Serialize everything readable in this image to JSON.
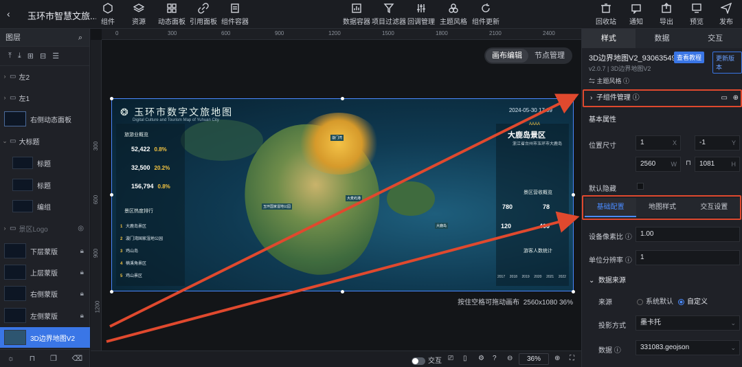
{
  "topbar": {
    "title": "玉环市智慧文旅...",
    "left_tools": [
      "组件",
      "资源",
      "动态面板",
      "引用面板",
      "组件容器"
    ],
    "center_tools": [
      "数据容器",
      "项目过滤器",
      "回调管理",
      "主题风格",
      "组件更新"
    ],
    "right_tools": [
      "回收站",
      "通知",
      "导出",
      "预览",
      "发布"
    ]
  },
  "layers": {
    "header": "图层",
    "items": [
      {
        "label": "左2",
        "type": "folder"
      },
      {
        "label": "左1",
        "type": "folder"
      },
      {
        "label": "右侧动态面板",
        "type": "panel"
      },
      {
        "label": "大标题",
        "type": "folder-open"
      },
      {
        "label": "标题",
        "type": "child"
      },
      {
        "label": "标题",
        "type": "child"
      },
      {
        "label": "编组",
        "type": "child"
      },
      {
        "label": "景区Logo",
        "type": "folder-dim"
      },
      {
        "label": "下层蒙版",
        "type": "locked"
      },
      {
        "label": "上层蒙版",
        "type": "locked"
      },
      {
        "label": "右侧蒙版",
        "type": "locked"
      },
      {
        "label": "左侧蒙版",
        "type": "locked"
      },
      {
        "label": "3D边界地图V2",
        "type": "selected"
      }
    ]
  },
  "canvas": {
    "ruler_h": [
      "0",
      "300",
      "600",
      "900",
      "1200",
      "1500",
      "1800",
      "2100",
      "2400"
    ],
    "ruler_v": [
      "300",
      "600",
      "900",
      "1200"
    ],
    "mode_tabs": [
      "画布编辑",
      "节点管理"
    ],
    "hint": "按住空格可拖动画布",
    "size_info": "2560x1080 36%",
    "interact_label": "交互",
    "zoom": "36%"
  },
  "artboard": {
    "title": "玉环市数字文旅地图",
    "subtitle": "Digital Culture and Tourism Map of Yuhuan City",
    "date": "2024-05-30 17:09",
    "scene_name": "大鹿岛景区",
    "scene_rating": "AAAA",
    "scene_sub": "浙江省台州市玉环市大鹿岛",
    "left_section1": "旅游业概览",
    "stats": [
      {
        "value": "52,422",
        "pct": "0.8%"
      },
      {
        "value": "32,500",
        "pct": "20.2%"
      },
      {
        "value": "156,794",
        "pct": "0.8%"
      }
    ],
    "left_section2": "景区热度排行",
    "ranking": [
      "大鹿岛景区",
      "漩门湾国家湿地公园",
      "鸡山岛",
      "楠溪角景区",
      "鸡山景区"
    ],
    "right_section1": "景区营收概览",
    "right_values": [
      "780",
      "78",
      "120",
      "400"
    ],
    "right_section2": "游客人数统计",
    "years": [
      "2017",
      "2018",
      "2019",
      "2020",
      "2021",
      "2022"
    ],
    "map_labels": [
      "漩门湾",
      "大麦屿港",
      "大鹿岛",
      "玉环国家湿地公园"
    ]
  },
  "props": {
    "tabs": [
      "样式",
      "数据",
      "交互"
    ],
    "component_name": "3D边界地图V2_93063549",
    "doc_btn": "查看教程",
    "update_btn": "更新版本",
    "version": "v2.0.7 | 3D边界地图V2",
    "theme": "主题风格",
    "sub_manage": "子组件管理",
    "basic": "基本属性",
    "pos_label": "位置尺寸",
    "x": "1",
    "y": "-1",
    "w": "2560",
    "h": "1081",
    "hidden_label": "默认隐藏",
    "sub_tabs": [
      "基础配置",
      "地图样式",
      "交互设置"
    ],
    "dpr_label": "设备像素比",
    "dpr": "1.00",
    "res_label": "单位分辨率",
    "res": "1",
    "datasource": "数据来源",
    "source_label": "来源",
    "source_opts": [
      "系统默认",
      "自定义"
    ],
    "proj_label": "投影方式",
    "proj": "墨卡托",
    "data_label": "数据",
    "data_val": "331083.geojson"
  },
  "colors": {
    "accent": "#3a76e6",
    "annotation": "#e0492e"
  }
}
